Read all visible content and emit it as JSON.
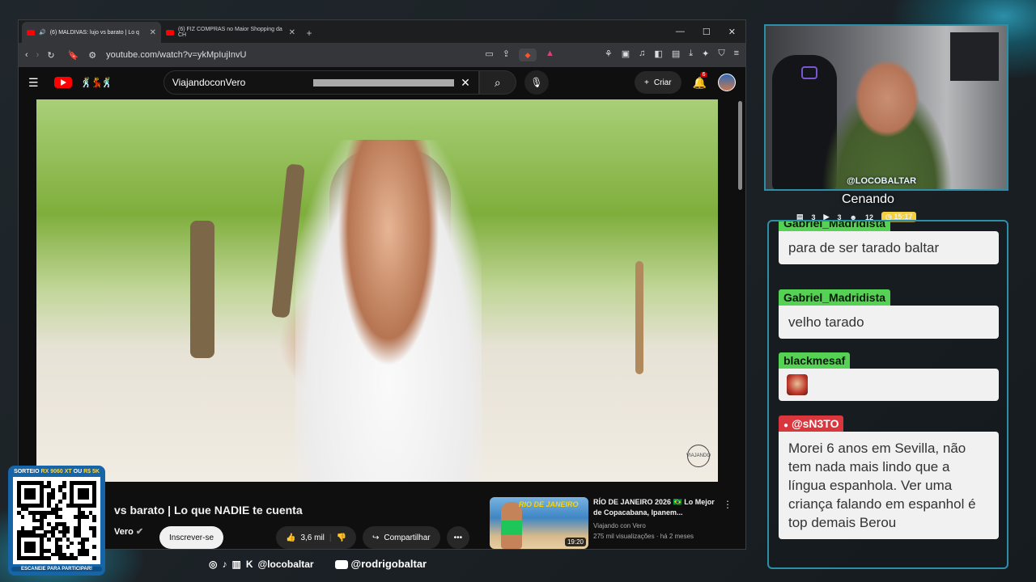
{
  "browser": {
    "tabs": [
      {
        "label": "(6) MALDIVAS: lujo vs barato | Lo q",
        "active": true
      },
      {
        "label": "(6) FIZ COMPRAS no Maior Shopping da CH",
        "active": false
      }
    ],
    "url": "youtube.com/watch?v=ykMpIujInvU"
  },
  "youtube": {
    "search_value": "ViajandoconVero",
    "create_label": "Criar",
    "notification_count": "6",
    "video_title": "vs barato | Lo que NADIE te cuenta",
    "channel_name": "Vero",
    "subscribe_label": "Inscrever-se",
    "like_count": "3,6 mil",
    "share_label": "Compartilhar",
    "recommended": {
      "thumb_text": "RIO DE JANEIRO",
      "duration": "19:20",
      "title": "RÍO DE JANEIRO 2026 🇧🇷 Lo Mejor de Copacabana, Ipanem...",
      "channel": "Viajando con Vero",
      "meta": "275 mil visualizações · há 2 meses"
    },
    "watermark": "VIAJANDO"
  },
  "stream": {
    "cam_tag": "@LOCOBALTAR",
    "cam_status": "Cenando",
    "stats": [
      "3",
      "3",
      "12"
    ],
    "clock": "15:17"
  },
  "chat": [
    {
      "user": "Gabriel_Madridista",
      "text": "para de ser tarado baltar"
    },
    {
      "user": "Gabriel_Madridista",
      "text": "velho tarado"
    },
    {
      "user": "blackmesaf",
      "text": ""
    },
    {
      "user": "@sN3TO",
      "text": "Morei 6 anos em Sevilla, não tem nada mais lindo que a língua espanhola. Ver uma criança falando em espanhol é top demais Berou"
    }
  ],
  "qr": {
    "header_prefix": "SORTEIO",
    "header_item": "RX 9060 XT",
    "header_mid": "OU",
    "header_prize": "R$ 5K",
    "footer": "ESCANEIE PARA PARTICIPAR!"
  },
  "socials": {
    "handle1": "@locobaltar",
    "handle2": "@rodrigobaltar"
  },
  "colors": {
    "accent": "#2d8fa5",
    "chat_name": "#55d154",
    "chat_name_alt": "#d9363e",
    "yt_red": "#ff0000"
  }
}
